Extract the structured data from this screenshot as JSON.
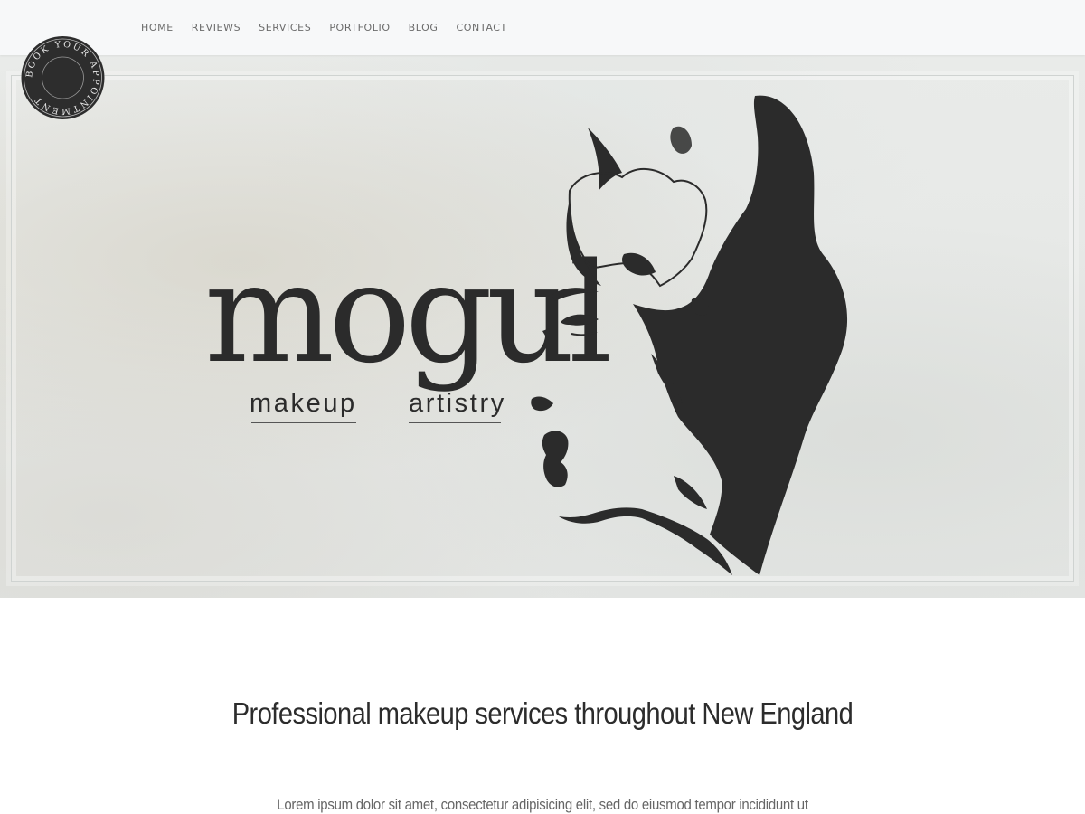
{
  "nav": {
    "items": [
      {
        "label": "HOME"
      },
      {
        "label": "REVIEWS"
      },
      {
        "label": "SERVICES"
      },
      {
        "label": "PORTFOLIO"
      },
      {
        "label": "BLOG"
      },
      {
        "label": "CONTACT"
      }
    ]
  },
  "badge": {
    "text": "BOOK YOUR APPOINTMENT"
  },
  "hero": {
    "logo_word": "mogul",
    "logo_sub_left": "makeup",
    "logo_sub_right": "artistry"
  },
  "content": {
    "tagline": "Professional makeup services throughout New England",
    "intro": "Lorem ipsum dolor sit amet, consectetur adipisicing elit, sed do eiusmod tempor incididunt ut"
  },
  "colors": {
    "nav_bg": "#f7f8f9",
    "nav_text": "#6b6b6b",
    "hero_bg": "#e8eae8",
    "ink": "#2b2b2b"
  }
}
